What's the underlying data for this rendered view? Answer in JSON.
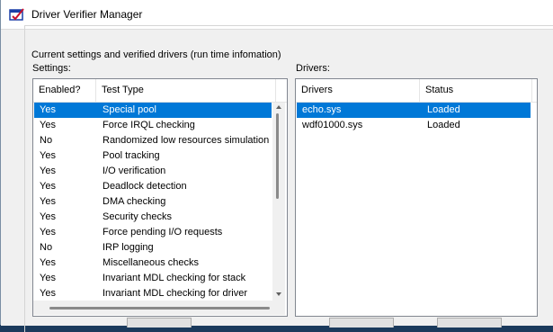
{
  "window": {
    "title": "Driver Verifier Manager"
  },
  "group": {
    "label": "Current settings and verified drivers (run time infomation)"
  },
  "settings": {
    "label": "Settings:",
    "columns": [
      "Enabled?",
      "Test Type"
    ],
    "rows": [
      {
        "enabled": "Yes",
        "test": "Special pool",
        "selected": true
      },
      {
        "enabled": "Yes",
        "test": "Force IRQL checking"
      },
      {
        "enabled": "No",
        "test": "Randomized low resources simulation"
      },
      {
        "enabled": "Yes",
        "test": "Pool tracking"
      },
      {
        "enabled": "Yes",
        "test": "I/O verification"
      },
      {
        "enabled": "Yes",
        "test": "Deadlock detection"
      },
      {
        "enabled": "Yes",
        "test": "DMA checking"
      },
      {
        "enabled": "Yes",
        "test": "Security checks"
      },
      {
        "enabled": "Yes",
        "test": "Force pending I/O requests"
      },
      {
        "enabled": "No",
        "test": "IRP logging"
      },
      {
        "enabled": "Yes",
        "test": "Miscellaneous checks"
      },
      {
        "enabled": "Yes",
        "test": "Invariant MDL checking for stack"
      },
      {
        "enabled": "Yes",
        "test": "Invariant MDL checking for driver"
      }
    ]
  },
  "drivers": {
    "label": "Drivers:",
    "columns": [
      "Drivers",
      "Status"
    ],
    "rows": [
      {
        "name": "echo.sys",
        "status": "Loaded",
        "selected": true
      },
      {
        "name": "wdf01000.sys",
        "status": "Loaded"
      }
    ]
  },
  "colors": {
    "selection": "#0078d7",
    "dialog_bg": "#f0f0f0"
  },
  "icons": {
    "app": "driver-verifier-icon"
  }
}
